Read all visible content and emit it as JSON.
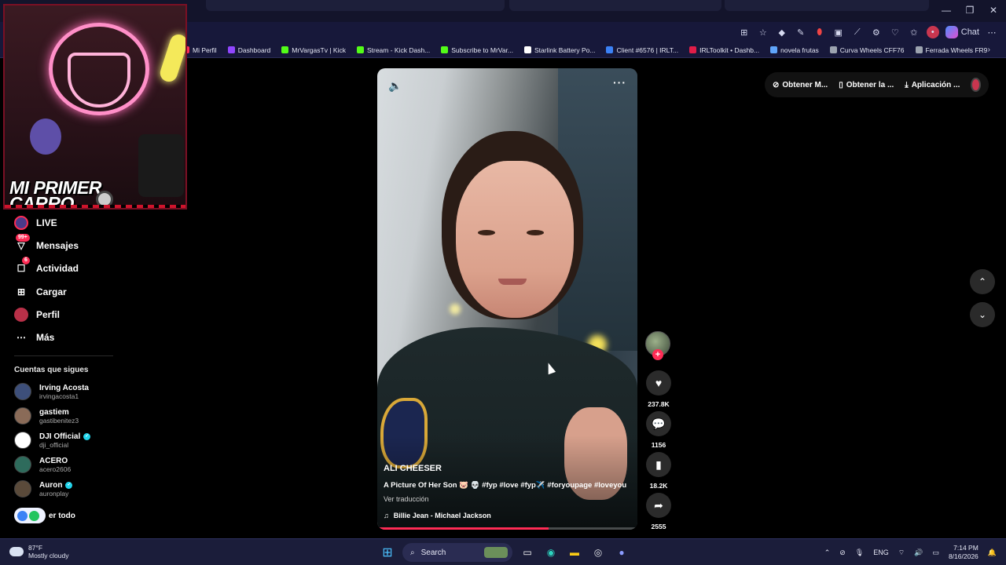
{
  "browser": {
    "chat_label": "Chat",
    "bookmarks": [
      {
        "label": "Mi Perfil",
        "icon": "profile-icon",
        "color": "#fe2c55"
      },
      {
        "label": "Dashboard",
        "icon": "twitch-icon",
        "color": "#9146ff"
      },
      {
        "label": "MrVargasTv | Kick",
        "icon": "kick-icon",
        "color": "#53fc18"
      },
      {
        "label": "Stream - Kick Dash...",
        "icon": "kick-icon",
        "color": "#53fc18"
      },
      {
        "label": "Subscribe to MrVar...",
        "icon": "kick-icon",
        "color": "#53fc18"
      },
      {
        "label": "Starlink Battery Po...",
        "icon": "starlink-icon",
        "color": "#ffffff"
      },
      {
        "label": "Client #6576 | IRLT...",
        "icon": "irl-icon",
        "color": "#3b82f6"
      },
      {
        "label": "IRLToolkit • Dashb...",
        "icon": "irltoolkit-icon",
        "color": "#e11d48"
      },
      {
        "label": "novela frutas",
        "icon": "doc-icon",
        "color": "#60a5fa"
      },
      {
        "label": "Curva Wheels CFF76",
        "icon": "wheel-icon",
        "color": "#9ca3af"
      },
      {
        "label": "Ferrada Wheels FR9",
        "icon": "wheel-icon",
        "color": "#9ca3af"
      }
    ]
  },
  "webcam": {
    "title_line1": "MI PRIMER",
    "title_line2": "CARRO"
  },
  "sidebar": {
    "items": [
      {
        "label": "LIVE",
        "icon": "live-avatar-icon"
      },
      {
        "label": "Mensajes",
        "icon": "messages-icon",
        "badge": "99+"
      },
      {
        "label": "Actividad",
        "icon": "activity-icon",
        "badge": "6"
      },
      {
        "label": "Cargar",
        "icon": "upload-icon"
      },
      {
        "label": "Perfil",
        "icon": "profile-avatar-icon"
      },
      {
        "label": "Más",
        "icon": "more-icon"
      }
    ],
    "following_title": "Cuentas que sigues",
    "accounts": [
      {
        "name": "Irving Acosta",
        "handle": "irvingacosta1",
        "verified": false,
        "color": "#3d4f7a"
      },
      {
        "name": "gastiem",
        "handle": "gastibenitez3",
        "verified": false,
        "color": "#8a6b58"
      },
      {
        "name": "DJI Official",
        "handle": "dji_official",
        "verified": true,
        "color": "#ffffff"
      },
      {
        "name": "ACERO",
        "handle": "acero2606",
        "verified": false,
        "color": "#2e6b5c"
      },
      {
        "name": "Auron",
        "handle": "auronplay",
        "verified": true,
        "color": "#5a4a3a"
      }
    ],
    "see_all": "er todo"
  },
  "video": {
    "author": "ALI CHEESER",
    "caption": "A Picture Of Her Son 🐷 💀 #fyp #love #fyp✈️ #foryoupage #loveyou",
    "translate": "Ver traducción",
    "music": "Billie Jean - Michael Jackson",
    "progress": 0.66
  },
  "actions": {
    "likes": "237.8K",
    "comments": "1156",
    "saves": "18.2K",
    "shares": "2555"
  },
  "topbar": {
    "coins": "Obtener M...",
    "app": "Obtener la ...",
    "download": "Aplicación ..."
  },
  "taskbar": {
    "temp": "87°F",
    "weather": "Mostly cloudy",
    "search": "Search",
    "lang": "ENG",
    "time": "7:14 PM",
    "date": "8/16/2026"
  }
}
